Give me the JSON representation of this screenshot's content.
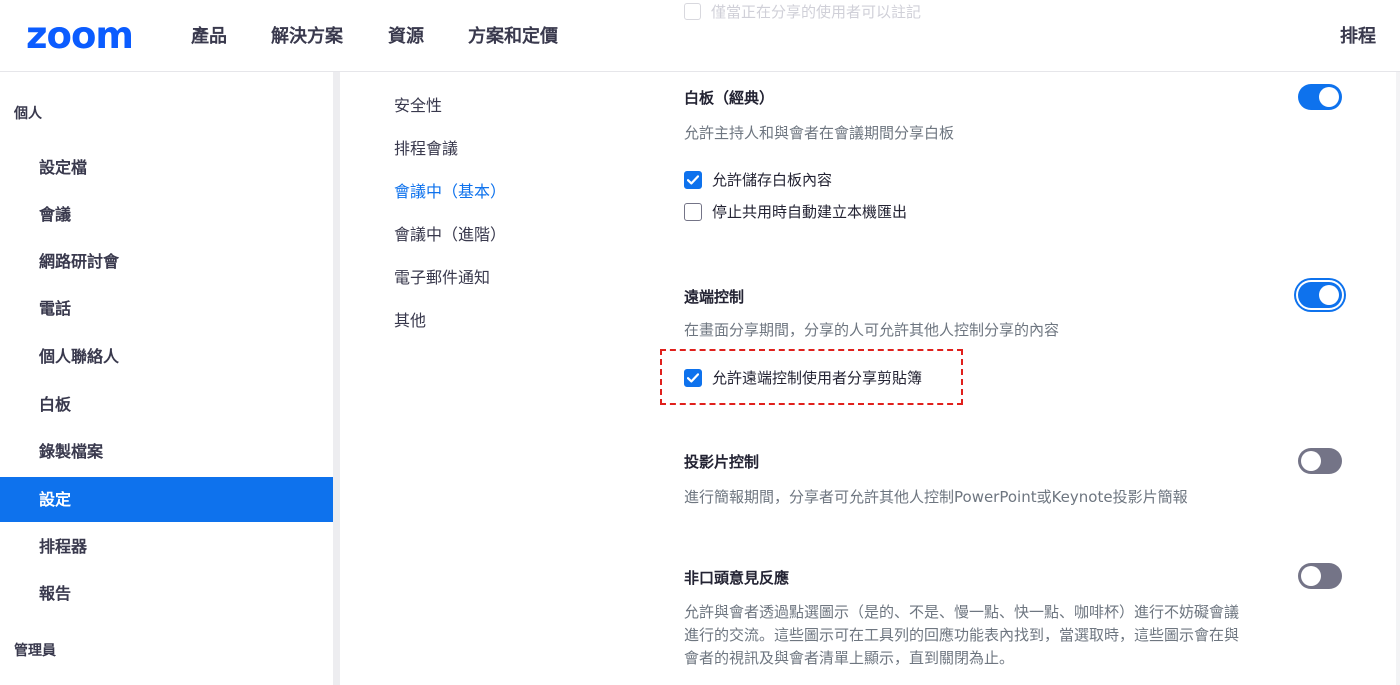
{
  "header": {
    "logo_text": "zoom",
    "nav": [
      "產品",
      "解決方案",
      "資源",
      "方案和定價"
    ],
    "right_link": "排程",
    "ghost_text": "僅當正在分享的使用者可以註記"
  },
  "sidebar": {
    "personal_heading": "個人",
    "items": [
      "設定檔",
      "會議",
      "網路研討會",
      "電話",
      "個人聯絡人",
      "白板",
      "錄製檔案",
      "設定",
      "排程器",
      "報告"
    ],
    "active_item": "設定",
    "admin_heading": "管理員"
  },
  "subnav": {
    "items": [
      "安全性",
      "排程會議",
      "會議中（基本）",
      "會議中（進階）",
      "電子郵件通知",
      "其他"
    ],
    "active_item": "會議中（基本）"
  },
  "settings": {
    "whiteboard": {
      "title": "白板（經典）",
      "desc": "允許主持人和與會者在會議期間分享白板",
      "enabled": true,
      "options": [
        {
          "label": "允許儲存白板內容",
          "checked": true
        },
        {
          "label": "停止共用時自動建立本機匯出",
          "checked": false
        }
      ]
    },
    "remote_control": {
      "title": "遠端控制",
      "desc": "在畫面分享期間，分享的人可允許其他人控制分享的內容",
      "enabled": true,
      "options": [
        {
          "label": "允許遠端控制使用者分享剪貼簿",
          "checked": true
        }
      ]
    },
    "slide_control": {
      "title": "投影片控制",
      "desc": "進行簡報期間，分享者可允許其他人控制PowerPoint或Keynote投影片簡報",
      "enabled": false
    },
    "nonverbal_feedback": {
      "title": "非口頭意見反應",
      "desc_lines": [
        "允許與會者透過點選圖示（是的、不是、慢一點、快一點、咖啡杯）進行不妨礙會議",
        "進行的交流。這些圖示可在工具列的回應功能表內找到，當選取時，這些圖示會在與",
        "會者的視訊及與會者清單上顯示，直到關閉為止。"
      ],
      "enabled": false
    }
  },
  "colors": {
    "brand_blue": "#0b5cff",
    "accent_blue": "#0e72ed",
    "toggle_off": "#747487",
    "highlight_red": "#e0201c"
  }
}
